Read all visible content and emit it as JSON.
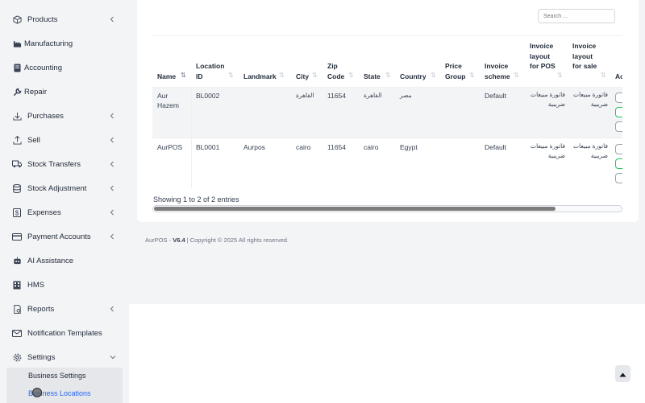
{
  "sidebar": {
    "items": [
      {
        "label": "Products",
        "icon": "cube-icon",
        "chevron": true
      },
      {
        "label": "Manufacturing",
        "icon": "factory-icon",
        "chevron": false
      },
      {
        "label": "Accounting",
        "icon": "ledger-icon",
        "chevron": false
      },
      {
        "label": "Repair",
        "icon": "wrench-icon",
        "chevron": false
      },
      {
        "label": "Purchases",
        "icon": "download-icon",
        "chevron": true
      },
      {
        "label": "Sell",
        "icon": "upload-icon",
        "chevron": true
      },
      {
        "label": "Stock Transfers",
        "icon": "truck-icon",
        "chevron": true
      },
      {
        "label": "Stock Adjustment",
        "icon": "database-icon",
        "chevron": true
      },
      {
        "label": "Expenses",
        "icon": "dollar-icon",
        "chevron": true
      },
      {
        "label": "Payment Accounts",
        "icon": "credit-card-icon",
        "chevron": true
      },
      {
        "label": "AI Assistance",
        "icon": "robot-icon",
        "chevron": false
      },
      {
        "label": "HMS",
        "icon": "building-icon",
        "chevron": false
      },
      {
        "label": "Reports",
        "icon": "report-icon",
        "chevron": true
      },
      {
        "label": "Notification Templates",
        "icon": "envelope-icon",
        "chevron": false
      },
      {
        "label": "Settings",
        "icon": "gear-icon",
        "chevron": true
      }
    ],
    "submenu": [
      {
        "label": "Business Settings"
      },
      {
        "label": "Business Locations"
      }
    ]
  },
  "search": {
    "placeholder": "Search ..."
  },
  "table": {
    "headers": [
      {
        "label": "Name"
      },
      {
        "label": "Location ID"
      },
      {
        "label": "Landmark"
      },
      {
        "label": "City"
      },
      {
        "label": "Zip Code"
      },
      {
        "label": "State"
      },
      {
        "label": "Country"
      },
      {
        "label": "Price Group"
      },
      {
        "label": "Invoice scheme"
      },
      {
        "label": "Invoice layout for POS"
      },
      {
        "label": "Invoice layout for sale"
      },
      {
        "label": "Ac"
      }
    ],
    "rows": [
      {
        "name": "Aur Hazem",
        "location_id": "BL0002",
        "landmark": "",
        "city": "القاهرة",
        "zip": "11654",
        "state": "القاهرة",
        "country": "مصر",
        "price_group": "",
        "scheme": "Default",
        "layout_pos": "فاتورة مبيعات ضريبية",
        "layout_sale": "فاتورة مبيعات ضريبية"
      },
      {
        "name": "AurPOS",
        "location_id": "BL0001",
        "landmark": "Aurpos",
        "city": "cairo",
        "zip": "11654",
        "state": "cairo",
        "country": "Egypt",
        "price_group": "",
        "scheme": "Default",
        "layout_pos": "فاتورة مبيعات ضريبية",
        "layout_sale": "فاتورة مبيعات ضريبية"
      }
    ],
    "info": "Showing 1 to 2 of 2 entries",
    "scroll_fraction": 0.86
  },
  "footer": {
    "app": "AurPOS",
    "version": "V6.4",
    "copyright": "| Copyright © 2025 All rights reserved."
  },
  "colors": {
    "accent": "#2563eb",
    "sidebar_bg": "#f3f4f6",
    "button_green": "#22c55e"
  }
}
